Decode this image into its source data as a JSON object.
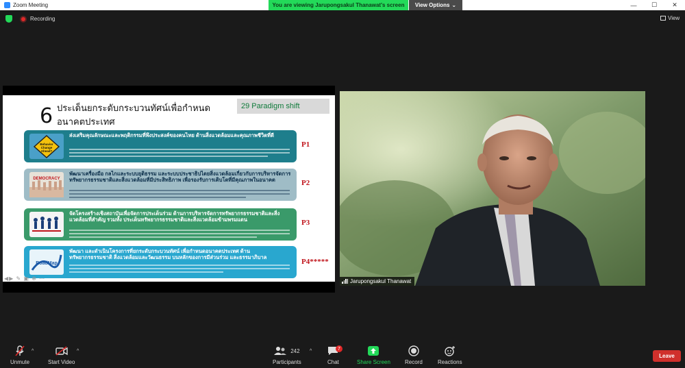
{
  "window": {
    "title": "Zoom Meeting",
    "share_banner": "You are viewing Jarupongsakul Thanawat's screen",
    "view_options": "View Options",
    "controls": [
      "—",
      "☐",
      "✕"
    ]
  },
  "infobar": {
    "recording_label": "Recording",
    "view_label": "View"
  },
  "slide": {
    "number": "6",
    "heading_line1": "ประเด็นยกระดับกระบวนทัศน์เพื่อกำหนด",
    "heading_line2": "อนาคตประเทศ",
    "paradigm_label": "29 Paradigm shift",
    "cards": [
      {
        "title": "ส่งเสริมคุณลักษณะและพฤติกรรมที่พึงประสงค์ของคนไทย ด้านสิ่งแวดล้อมและคุณภาพชีวิตที่ดี",
        "body": "",
        "tag": "P1",
        "image_label": "Behavior Change Ahead?",
        "color": "#1e7e8c"
      },
      {
        "title": "พัฒนาเครื่องมือ กลไกและระบบยุติธรรม และระบบประชาธิปไตยสิ่งแวดล้อมเกี่ยวกับการบริหารจัดการทรัพยากรธรรมชาติและสิ่งแวดล้อมที่มีประสิทธิภาพ เพื่อรองรับการเติบโตที่มีคุณภาพในอนาคต",
        "body": "",
        "tag": "P2",
        "image_label": "DEMOCRACY",
        "color": "#9fbcc6"
      },
      {
        "title": "จัดโครงสร้างเชิงสถาบันเพื่อจัดการประเด็นร่วม ด้านการบริหารจัดการทรัพยากรธรรมชาติและสิ่งแวดล้อมที่สำคัญ รวมทั้ง ประเด็นทรัพยากรธรรมชาติและสิ่งแวดล้อมข้ามพรมแดน",
        "body": "",
        "tag": "P3",
        "image_label": "",
        "color": "#3a9a6a"
      },
      {
        "title": "พัฒนา และดำเนินโครงการที่ยกระดับกระบวนทัศน์ เพื่อกำหนดอนาคตประเทศ ด้านทรัพยากรธรรมชาติ สิ่งแวดล้อมและวัฒนธรรม บนหลักของการมีส่วนร่วม และธรรมาภิบาล",
        "body": "",
        "tag": "P4*****",
        "image_label": "RoadMap",
        "color": "#29a7cf"
      }
    ]
  },
  "video": {
    "participant_name": "Jarupongsakul Thanawat"
  },
  "toolbar": {
    "unmute": "Unmute",
    "start_video": "Start Video",
    "participants_count": "242",
    "participants": "Participants",
    "chat": "Chat",
    "chat_badge": "7",
    "share_screen": "Share Screen",
    "record": "Record",
    "reactions": "Reactions",
    "leave": "Leave"
  },
  "colors": {
    "accent_green": "#23d959",
    "leave_red": "#d0302c",
    "p_label_red": "#c0141b"
  }
}
